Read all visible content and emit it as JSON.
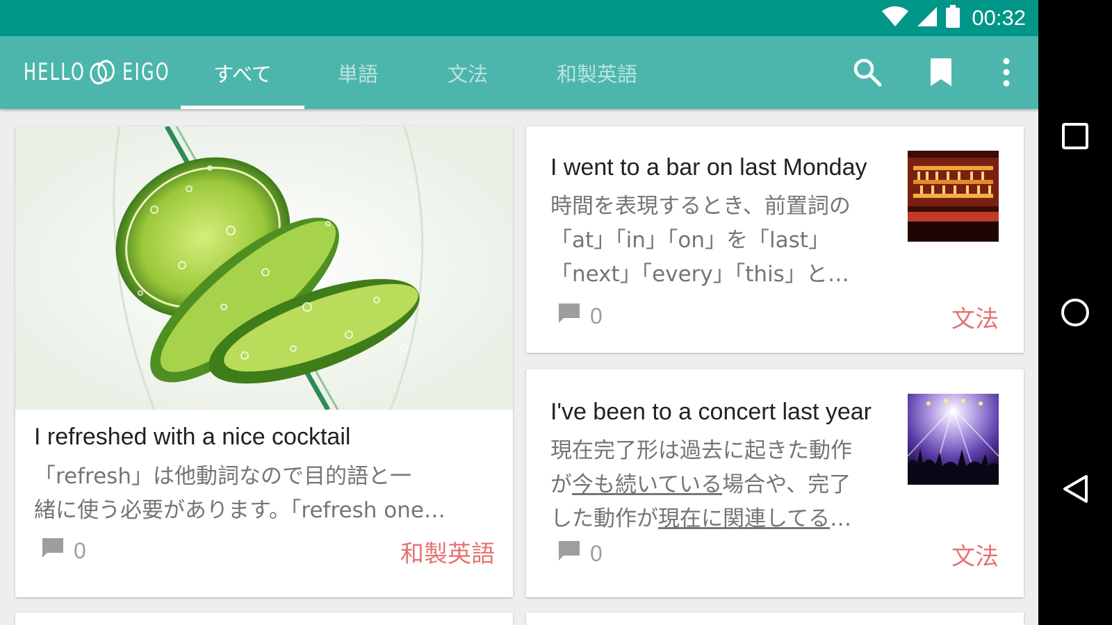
{
  "status_bar": {
    "time": "00:32",
    "icons": [
      "wifi-icon",
      "cell-signal-icon",
      "battery-icon"
    ]
  },
  "app": {
    "logo_left": "HELLO",
    "logo_right": "EIGO",
    "tabs": [
      {
        "label": "すべて",
        "active": true
      },
      {
        "label": "単語",
        "active": false
      },
      {
        "label": "文法",
        "active": false
      },
      {
        "label": "和製英語",
        "active": false
      }
    ],
    "actions": [
      "search-icon",
      "bookmark-icon",
      "more-vert-icon"
    ]
  },
  "colors": {
    "status_bar": "#009688",
    "app_bar": "#4db6ac",
    "category": "#e57373",
    "background": "#eeeeee"
  },
  "cards": [
    {
      "title": "I refreshed with a nice cocktail",
      "body_line1": "「refresh」は他動詞なので目的語と一",
      "body_line2": "緒に使う必要があります。「refresh one…",
      "comments": "0",
      "category": "和製英語",
      "image": "lime-soda-image"
    },
    {
      "title": "I went to a bar on last Monday",
      "body_line1": "時間を表現するとき、前置詞の",
      "body_line2": "「at」「in」「on」を「last」",
      "body_line3": "「next」「every」「this」と…",
      "comments": "0",
      "category": "文法",
      "image": "bar-image"
    },
    {
      "title": "I've been to a concert last year",
      "body_line1": "現在完了形は過去に起きた動作",
      "body_line2_a": "が",
      "body_line2_u": "今も続いている",
      "body_line2_b": "場合や、完了",
      "body_line3_a": "した動作が",
      "body_line3_u": "現在に関連してる",
      "body_line3_b": "…",
      "comments": "0",
      "category": "文法",
      "image": "concert-image"
    }
  ],
  "nav_bar": [
    "recents-icon",
    "home-icon",
    "back-icon"
  ]
}
